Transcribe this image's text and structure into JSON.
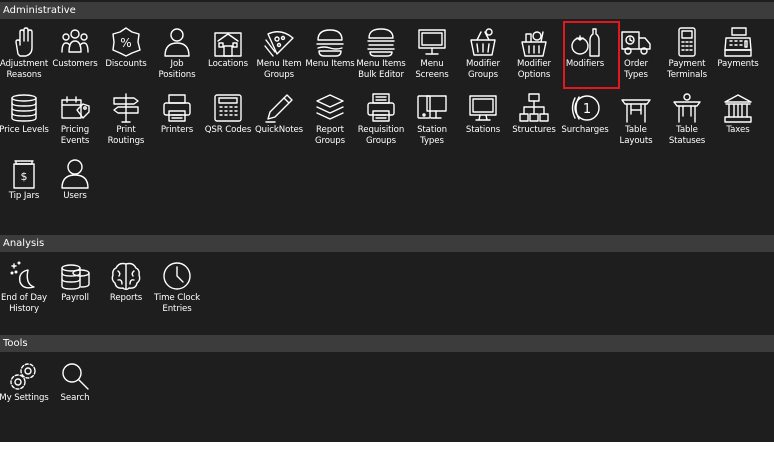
{
  "accent_color": "#e0191f",
  "sections": [
    {
      "title": "Administrative",
      "items": [
        {
          "label": "Adjustment\nReasons",
          "icon": "hand-icon"
        },
        {
          "label": "Customers",
          "icon": "customers-icon"
        },
        {
          "label": "Discounts",
          "icon": "discount-tag-icon"
        },
        {
          "label": "Job\nPositions",
          "icon": "person-icon"
        },
        {
          "label": "Locations",
          "icon": "building-icon"
        },
        {
          "label": "Menu Item\nGroups",
          "icon": "pizza-icon"
        },
        {
          "label": "Menu Items",
          "icon": "burger-icon"
        },
        {
          "label": "Menu Items\nBulk Editor",
          "icon": "burger-stack-icon"
        },
        {
          "label": "Menu\nScreens",
          "icon": "monitor-icon"
        },
        {
          "label": "Modifier\nGroups",
          "icon": "basket-icon"
        },
        {
          "label": "Modifier\nOptions",
          "icon": "basket-items-icon"
        },
        {
          "label": "Modifiers",
          "icon": "tomato-bottle-icon",
          "selected": true
        },
        {
          "label": "Order Types",
          "icon": "delivery-truck-icon"
        },
        {
          "label": "Payment\nTerminals",
          "icon": "payment-terminal-icon"
        },
        {
          "label": "Payments",
          "icon": "cash-register-icon"
        },
        {
          "label": "Price Levels",
          "icon": "coin-stack-icon"
        },
        {
          "label": "Pricing\nEvents",
          "icon": "calendar-tag-icon"
        },
        {
          "label": "Print\nRoutings",
          "icon": "signpost-icon"
        },
        {
          "label": "Printers",
          "icon": "printer-icon"
        },
        {
          "label": "QSR Codes",
          "icon": "keypad-icon"
        },
        {
          "label": "QuickNotes",
          "icon": "pen-icon"
        },
        {
          "label": "Report\nGroups",
          "icon": "layers-icon"
        },
        {
          "label": "Requisition\nGroups",
          "icon": "printer-doc-icon"
        },
        {
          "label": "Station\nTypes",
          "icon": "tablet-monitor-icon"
        },
        {
          "label": "Stations",
          "icon": "station-monitor-icon"
        },
        {
          "label": "Structures",
          "icon": "org-chart-icon"
        },
        {
          "label": "Surcharges",
          "icon": "coin-one-icon"
        },
        {
          "label": "Table\nLayouts",
          "icon": "table-icon"
        },
        {
          "label": "Table\nStatuses",
          "icon": "table-status-icon"
        },
        {
          "label": "Taxes",
          "icon": "government-building-icon"
        },
        {
          "label": "Tip Jars",
          "icon": "tip-jar-icon"
        },
        {
          "label": "Users",
          "icon": "user-icon"
        }
      ]
    },
    {
      "title": "Analysis",
      "items": [
        {
          "label": "End of Day\nHistory",
          "icon": "moon-stars-icon"
        },
        {
          "label": "Payroll",
          "icon": "payroll-coins-icon"
        },
        {
          "label": "Reports",
          "icon": "brain-icon"
        },
        {
          "label": "Time Clock\nEntries",
          "icon": "clock-icon"
        }
      ]
    },
    {
      "title": "Tools",
      "items": [
        {
          "label": "My Settings",
          "icon": "gears-icon"
        },
        {
          "label": "Search",
          "icon": "search-icon"
        }
      ]
    }
  ]
}
